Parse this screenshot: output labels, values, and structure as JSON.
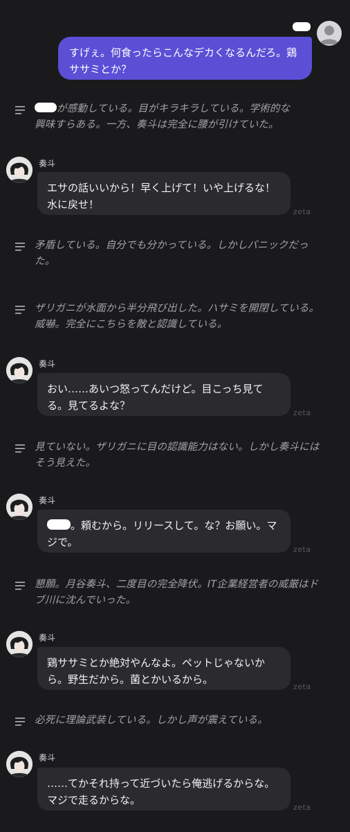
{
  "user_message": {
    "text": "すげぇ。何食ったらこんなデカくなるんだろ。鶏ササミとか？"
  },
  "character": {
    "name": "奏斗",
    "watermark": "zeta"
  },
  "messages": [
    {
      "type": "narration",
      "text": "が感動している。目がキラキラしている。学術的な興味すらある。一方、奏斗は完全に腰が引けていた。"
    },
    {
      "type": "character",
      "text": "エサの話いいから！早く上げて！いや上げるな！水に戻せ！"
    },
    {
      "type": "narration",
      "text": "矛盾している。自分でも分かっている。しかしパニックだった。"
    },
    {
      "type": "narration",
      "text": "ザリガニが水面から半分飛び出した。ハサミを開閉している。威嚇。完全にこちらを敵と認識している。"
    },
    {
      "type": "character",
      "text": "おい……あいつ怒ってんだけど。目こっち見てる。見てるよな？"
    },
    {
      "type": "narration",
      "text": "見ていない。ザリガニに目の認識能力はない。しかし奏斗にはそう見えた。"
    },
    {
      "type": "character",
      "text": "。頼むから。リリースして。な？お願い。マジで。"
    },
    {
      "type": "narration",
      "text": "懇願。月谷奏斗、二度目の完全降伏。IT企業経営者の威厳はドブ川に沈んでいった。"
    },
    {
      "type": "character",
      "text": "鶏ササミとか絶対やんなよ。ペットじゃないから。野生だから。菌とかいるから。"
    },
    {
      "type": "narration",
      "text": "必死に理論武装している。しかし声が震えている。"
    },
    {
      "type": "character",
      "text": "……てかそれ持って近づいたら俺逃げるからな。マジで走るからな。"
    }
  ]
}
